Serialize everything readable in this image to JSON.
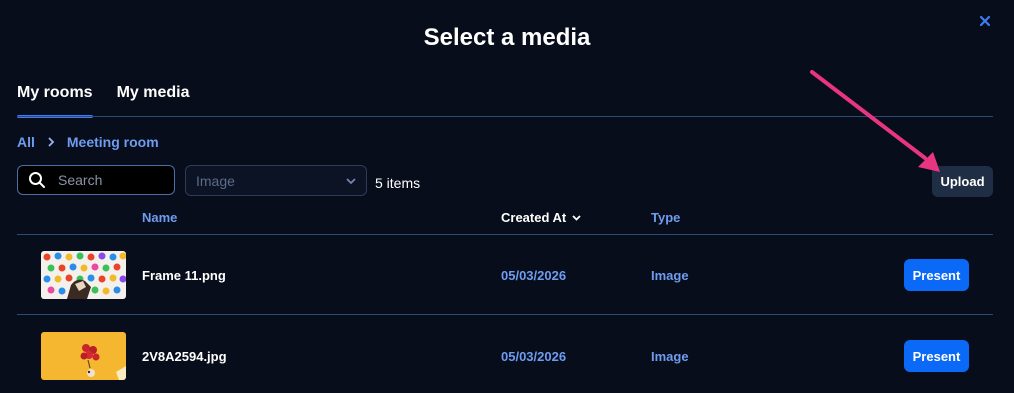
{
  "dialog": {
    "title": "Select a media",
    "close_icon": "close-icon"
  },
  "tabs": [
    {
      "label": "My rooms",
      "active": true
    },
    {
      "label": "My media",
      "active": false
    }
  ],
  "breadcrumb": {
    "items": [
      "All",
      "Meeting room"
    ],
    "separator_icon": "chevron-right-icon"
  },
  "toolbar": {
    "search_placeholder": "Search",
    "search_value": "",
    "type_filter_value": "Image",
    "item_count": "5 items",
    "upload_label": "Upload"
  },
  "table": {
    "columns": {
      "name": "Name",
      "created_at": "Created At",
      "type": "Type"
    },
    "sort_icon": "chevron-down-icon",
    "rows": [
      {
        "name": "Frame 11.png",
        "created_at": "05/03/2026",
        "type": "Image",
        "action": "Present"
      },
      {
        "name": "2V8A2594.jpg",
        "created_at": "05/03/2026",
        "type": "Image",
        "action": "Present"
      }
    ]
  },
  "colors": {
    "background": "#070d1a",
    "accent": "#3d7cf2",
    "primary_button": "#0a6af7",
    "annotation_arrow": "#e8357f"
  }
}
